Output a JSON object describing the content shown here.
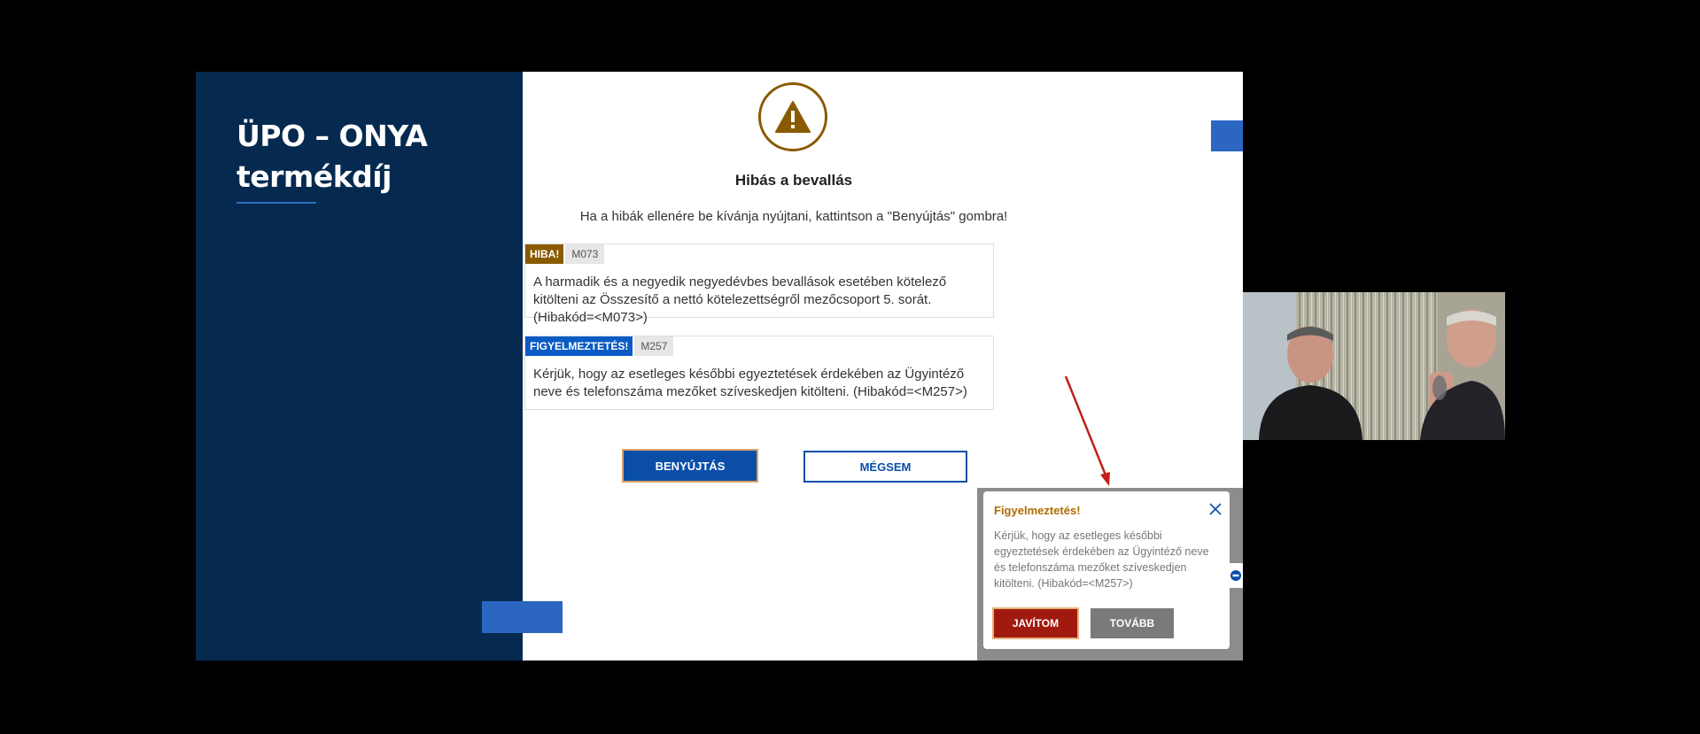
{
  "slide": {
    "title_line1": "ÜPO – ONYA",
    "title_line2": "termékdíj"
  },
  "dialog": {
    "title": "Hibás a bevallás",
    "subtitle": "Ha a hibák ellenére be kívánja nyújtani, kattintson a \"Benyújtás\" gombra!",
    "messages": [
      {
        "badge": "HIBA!",
        "code": "M073",
        "text": "A harmadik és a negyedik negyedévbes bevallások esetében kötelező kitölteni az Összesítő a nettó kötelezettségről mezőcsoport 5. sorát. (Hibakód=<M073>)"
      },
      {
        "badge": "FIGYELMEZTETÉS!",
        "code": "M257",
        "text": "Kérjük, hogy az esetleges későbbi egyeztetések érdekében az Ügyintéző neve és telefonszáma mezőket szíveskedjen kitölteni. (Hibakód=<M257>)"
      }
    ],
    "submit_label": "BENYÚJTÁS",
    "cancel_label": "MÉGSEM"
  },
  "popup": {
    "title": "Figyelmeztetés!",
    "text": "Kérjük, hogy az esetleges későbbi egyeztetések érdekében az Ügyintéző neve és telefonszáma mezőket szíveskedjen kitölteni. (Hibakód=<M257>)",
    "fix_label": "JAVÍTOM",
    "next_label": "TOVÁBB"
  },
  "icons": {
    "warning": "warning-triangle-icon",
    "close": "close-icon",
    "side_tab": "chat-icon"
  },
  "colors": {
    "panel": "#062a4f",
    "primary": "#0a4ea8",
    "error_badge": "#8a5a00",
    "warning_badge": "#0a5bc4",
    "fix_button": "#a11a10",
    "annotation_arrow": "#c0201a"
  }
}
